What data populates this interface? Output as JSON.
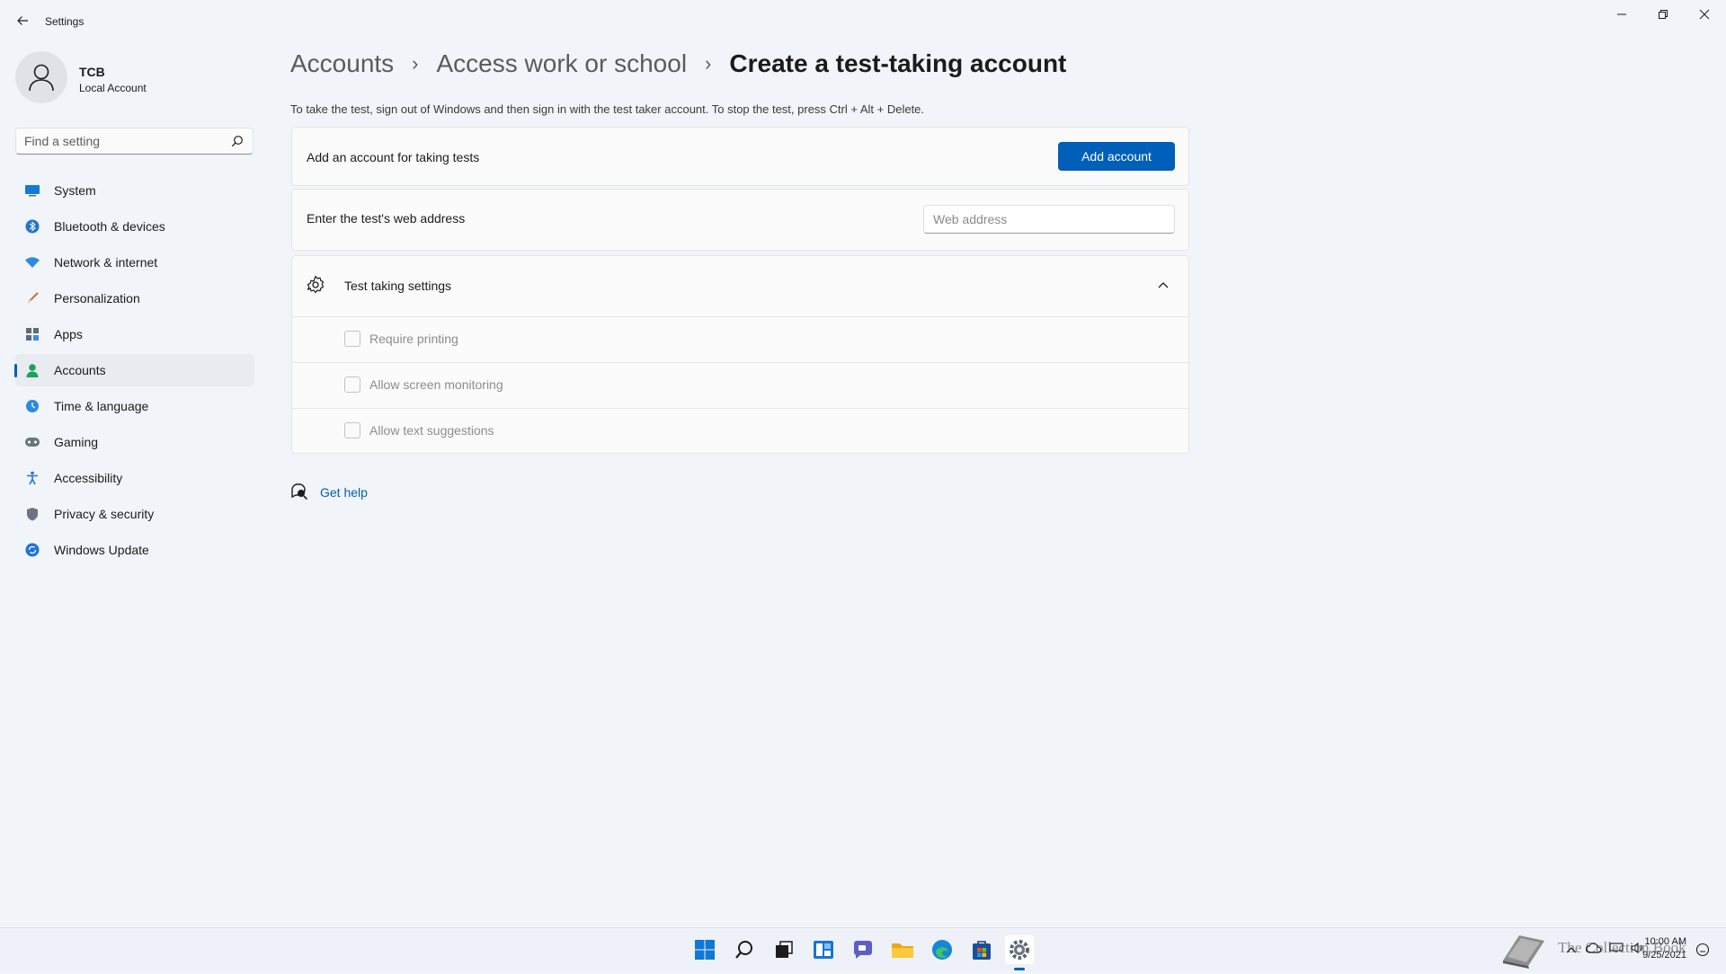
{
  "window": {
    "title": "Settings",
    "controls": [
      "minimize-icon",
      "restore-icon",
      "close-icon"
    ]
  },
  "user": {
    "name": "TCB",
    "type": "Local Account"
  },
  "search": {
    "placeholder": "Find a setting"
  },
  "sidebar": {
    "items": [
      {
        "label": "System",
        "icon": "system-icon"
      },
      {
        "label": "Bluetooth & devices",
        "icon": "bluetooth-icon"
      },
      {
        "label": "Network & internet",
        "icon": "wifi-icon"
      },
      {
        "label": "Personalization",
        "icon": "brush-icon"
      },
      {
        "label": "Apps",
        "icon": "apps-icon"
      },
      {
        "label": "Accounts",
        "icon": "person-icon",
        "selected": true
      },
      {
        "label": "Time & language",
        "icon": "globe-clock-icon"
      },
      {
        "label": "Gaming",
        "icon": "gamepad-icon"
      },
      {
        "label": "Accessibility",
        "icon": "accessibility-icon"
      },
      {
        "label": "Privacy & security",
        "icon": "shield-icon"
      },
      {
        "label": "Windows Update",
        "icon": "update-icon"
      }
    ]
  },
  "breadcrumb": {
    "items": [
      "Accounts",
      "Access work or school"
    ],
    "separator": "›",
    "current": "Create a test-taking account"
  },
  "description": "To take the test, sign out of Windows and then sign in with the test taker account. To stop the test, press Ctrl + Alt + Delete.",
  "add_account_card": {
    "label": "Add an account for taking tests",
    "button_label": "Add account"
  },
  "web_address_card": {
    "label": "Enter the test's web address",
    "input_placeholder": "Web address",
    "input_value": ""
  },
  "test_settings": {
    "label": "Test taking settings",
    "expanded": true,
    "options": [
      {
        "label": "Require printing",
        "checked": false
      },
      {
        "label": "Allow screen monitoring",
        "checked": false
      },
      {
        "label": "Allow text suggestions",
        "checked": false
      }
    ]
  },
  "help": {
    "label": "Get help"
  },
  "taskbar": {
    "icons": [
      "start-icon",
      "search-icon",
      "task-view-icon",
      "widgets-icon",
      "chat-icon",
      "file-explorer-icon",
      "edge-icon",
      "store-icon",
      "settings-icon"
    ],
    "active": "settings-icon",
    "clock": {
      "time": "10:00 AM",
      "date": "9/25/2021"
    },
    "watermark": "The Collection Book"
  },
  "colors": {
    "accent": "#005fb8",
    "background": "#f1f4f9",
    "card": "#fbfbfb"
  }
}
